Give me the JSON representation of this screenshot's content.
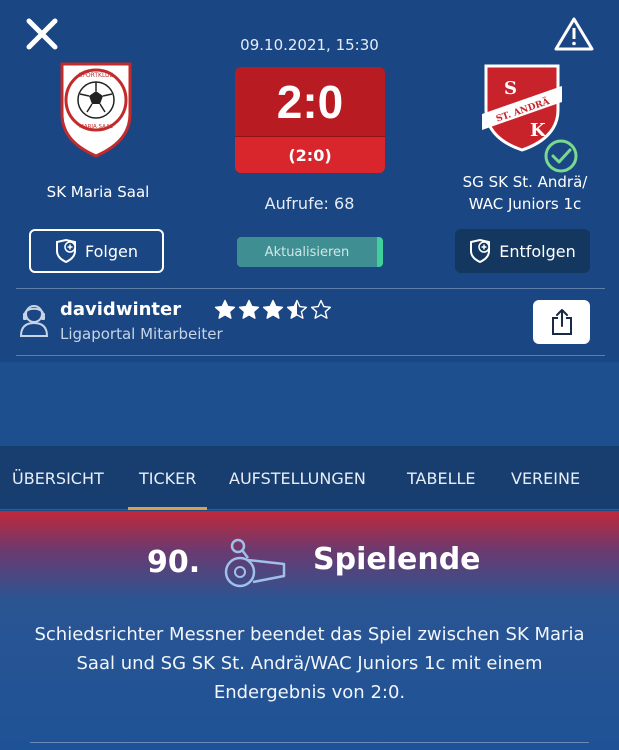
{
  "match": {
    "datetime": "09.10.2021, 15:30",
    "score": "2:0",
    "halftime": "(2:0)",
    "views": "Aufrufe: 68",
    "home_team": "SK Maria Saal",
    "away_team_line1": "SG SK St. Andrä/",
    "away_team_line2": "WAC Juniors 1c"
  },
  "crests": {
    "home_ring_text": "SPORTKLUB",
    "home_bottom_text": "MARIA SAAL",
    "away_letters": [
      "S",
      "K"
    ],
    "away_band_text": "ST. ANDRÄ"
  },
  "actions": {
    "follow_label": "Folgen",
    "unfollow_label": "Entfolgen",
    "refresh_label": "Aktualisieren"
  },
  "author": {
    "name": "davidwinter",
    "role": "Ligaportal Mitarbeiter",
    "rating": 3.5,
    "rating_max": 5
  },
  "tabs": [
    {
      "label": "ÜBERSICHT",
      "active": false
    },
    {
      "label": "TICKER",
      "active": true
    },
    {
      "label": "AUFSTELLUNGEN",
      "active": false
    },
    {
      "label": "TABELLE",
      "active": false
    },
    {
      "label": "VEREINE",
      "active": false
    }
  ],
  "event": {
    "minute": "90.",
    "title": "Spielende",
    "text": "Schiedsrichter Messner beendet das Spiel zwischen SK Maria Saal und SG SK St. Andrä/WAC Juniors 1c mit einem Endergebnis von 2:0."
  },
  "colors": {
    "background": "#1a4683",
    "score_red": "#b81c22",
    "tab_indicator": "#d9a14a",
    "refresh_accent": "#3ecf9a"
  }
}
